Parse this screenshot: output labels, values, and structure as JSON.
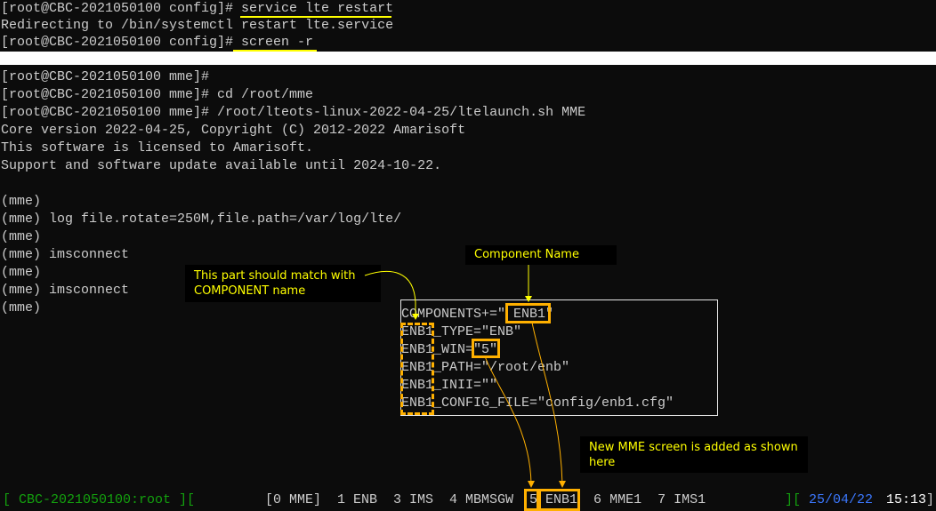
{
  "top_terminal": {
    "lines": [
      {
        "prompt": "[root@CBC-2021050100 config]# ",
        "cmd": "service lte restart"
      },
      {
        "prompt": "Redirecting to /bin/systemctl restart lte.service",
        "cmd": ""
      },
      {
        "prompt": "[root@CBC-2021050100 config]#",
        "cmd": " screen -r"
      }
    ]
  },
  "main_terminal": {
    "lines": [
      "[root@CBC-2021050100 mme]#",
      "[root@CBC-2021050100 mme]# cd /root/mme",
      "[root@CBC-2021050100 mme]# /root/lteots-linux-2022-04-25/ltelaunch.sh MME",
      "Core version 2022-04-25, Copyright (C) 2012-2022 Amarisoft",
      "This software is licensed to Amarisoft.",
      "Support and software update available until 2024-10-22.",
      "",
      "(mme)",
      "(mme) log file.rotate=250M,file.path=/var/log/lte/",
      "(mme)",
      "(mme) imsconnect",
      "(mme)",
      "(mme) imsconnect",
      "(mme)"
    ]
  },
  "config_snippet": [
    "COMPONENTS+=\" ENB1\"",
    "ENB1_TYPE=\"ENB\"",
    "ENB1_WIN=\"5\"",
    "ENB1_PATH=\"/root/enb\"",
    "ENB1_INII=\"\"",
    "ENB1_CONFIG_FILE=\"config/enb1.cfg\""
  ],
  "annotations": {
    "component_name": "Component Name",
    "match_note": "This part should match with COMPONENT name",
    "new_screen_note": "New MME screen is added as shown here"
  },
  "status_bar": {
    "host": "[ CBC-2021050100:root ][",
    "windows": "[0 MME]  1 ENB  3 IMS  4 MBMSGW  5 ENB1  6 MME1  7 IMS1",
    "sep": "][",
    "date": "25/04/22",
    "time": "15:13",
    "end": "]"
  },
  "colors": {
    "highlight": "#ffb000",
    "annotation_text": "#ffff00",
    "status_green": "#13a10e",
    "status_blue": "#3b78ff"
  }
}
